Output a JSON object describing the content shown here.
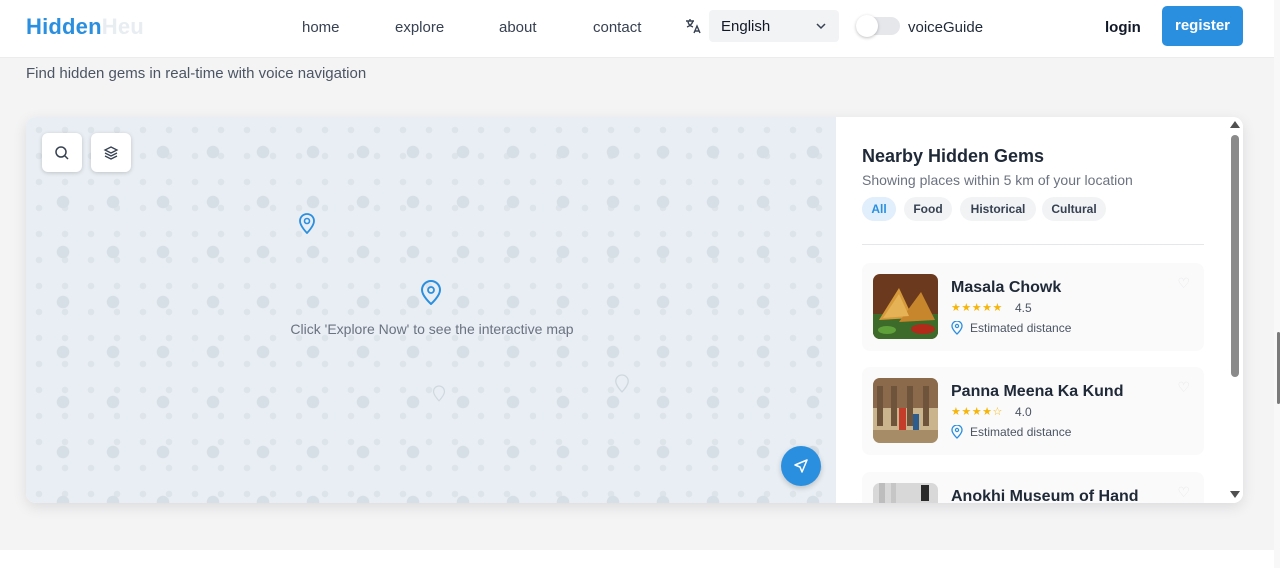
{
  "brand": {
    "part1": "Hidden",
    "part2": "Heu"
  },
  "nav": {
    "home": "home",
    "explore": "explore",
    "about": "about",
    "contact": "contact"
  },
  "language": {
    "selected": "English"
  },
  "voice_guide": {
    "label": "voiceGuide",
    "enabled": false
  },
  "auth": {
    "login": "login",
    "register": "register"
  },
  "tagline": "Find hidden gems in real-time with voice navigation",
  "map": {
    "hint": "Click 'Explore Now' to see the interactive map"
  },
  "panel": {
    "title": "Nearby Hidden Gems",
    "subtitle": "Showing places within 5 km of your location",
    "filters": [
      {
        "label": "All",
        "active": true
      },
      {
        "label": "Food",
        "active": false
      },
      {
        "label": "Historical",
        "active": false
      },
      {
        "label": "Cultural",
        "active": false
      }
    ],
    "places": [
      {
        "name": "Masala Chowk",
        "stars": "★★★★★",
        "rating": "4.5",
        "distance": "Estimated distance"
      },
      {
        "name": "Panna Meena Ka Kund",
        "stars": "★★★★☆",
        "rating": "4.0",
        "distance": "Estimated distance"
      },
      {
        "name": "Anokhi Museum of Hand",
        "stars": "",
        "rating": "",
        "distance": ""
      }
    ]
  },
  "colors": {
    "accent": "#2b8fe0",
    "star": "#f5b50a"
  }
}
